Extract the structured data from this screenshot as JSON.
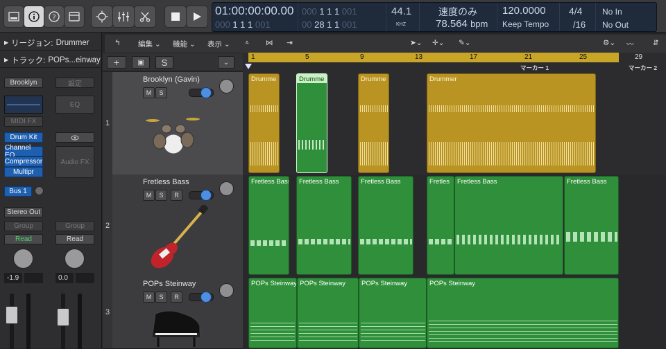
{
  "toolbar": {
    "buttons": [
      "library-icon",
      "inspector-icon",
      "quick-help-icon",
      "toolbar-icon",
      "smart-controls-icon",
      "mixer-icon",
      "editors-icon",
      "stop-icon",
      "play-icon"
    ]
  },
  "lcd": {
    "timecode": "01:00:00:00.00",
    "timecode_sub_dim": "000",
    "timecode_sub": "1 1 1",
    "timecode_sub_dim2": "001",
    "bars_dim": "000",
    "bars": "1 1 1",
    "bars_dim2": "001",
    "bars2_dim": "00",
    "bars2": "28 1 1",
    "bars2_dim2": "001",
    "sample_rate": "44.1",
    "sample_unit": "KHZ",
    "tempo_mode": "速度のみ",
    "bpm_value": "78.564",
    "bpm_unit": "bpm",
    "tempo": "120.0000",
    "keep_tempo": "Keep Tempo",
    "sig": "4/4",
    "division": "/16",
    "midi_in": "No In",
    "midi_out": "No Out"
  },
  "inspector": {
    "region_label": "リージョン:",
    "region_name": "Drummer",
    "track_label": "トラック:",
    "track_name": "POPs...einway",
    "left_strip": {
      "patch": "Brooklyn",
      "midi_fx": "MIDI FX",
      "instrument": "Drum Kit",
      "inserts": [
        "Channel EQ",
        "Compressor",
        "Multipr"
      ],
      "send": "Bus 1",
      "output": "Stereo Out",
      "group": "Group",
      "automation": "Read",
      "volume": "-1.9"
    },
    "right_strip": {
      "setting": "設定",
      "eq": "EQ",
      "audio_fx": "Audio FX",
      "group": "Group",
      "automation": "Read",
      "volume": "0.0"
    }
  },
  "track_buttons": {
    "add": "+",
    "s": "S"
  },
  "arrange_menu": {
    "edit": "編集",
    "function": "機能",
    "view": "表示"
  },
  "ruler": {
    "bars": [
      "1",
      "5",
      "9",
      "13",
      "17",
      "21",
      "25",
      "29"
    ],
    "marker1": "マーカー 1",
    "marker2": "マーカー 2"
  },
  "tracks": [
    {
      "num": "1",
      "name": "Brooklyn (Gavin)",
      "buttons": [
        "M",
        "S"
      ],
      "volume_fraction": 0.75
    },
    {
      "num": "2",
      "name": "Fretless Bass",
      "buttons": [
        "M",
        "S",
        "R"
      ],
      "volume_fraction": 0.75
    },
    {
      "num": "3",
      "name": "POPs Steinway",
      "buttons": [
        "M",
        "S",
        "R"
      ],
      "volume_fraction": 0.75
    }
  ],
  "regions": {
    "drummer": [
      "Drumme",
      "Drumme",
      "Drumme",
      "Drummer"
    ],
    "bass": [
      "Fretless Bass",
      "Fretless Bass",
      "Fretless Bass",
      "Fretles",
      "Fretless Bass",
      "Fretless Bass"
    ],
    "piano": [
      "POPs Steinway",
      "POPs Steinway",
      "POPs Steinway",
      "POPs Steinway"
    ]
  },
  "colors": {
    "drummer": "#b99422",
    "midi_green": "#2f8f3a",
    "cycle": "#c8a526",
    "lcd": "#1f2a3a"
  }
}
